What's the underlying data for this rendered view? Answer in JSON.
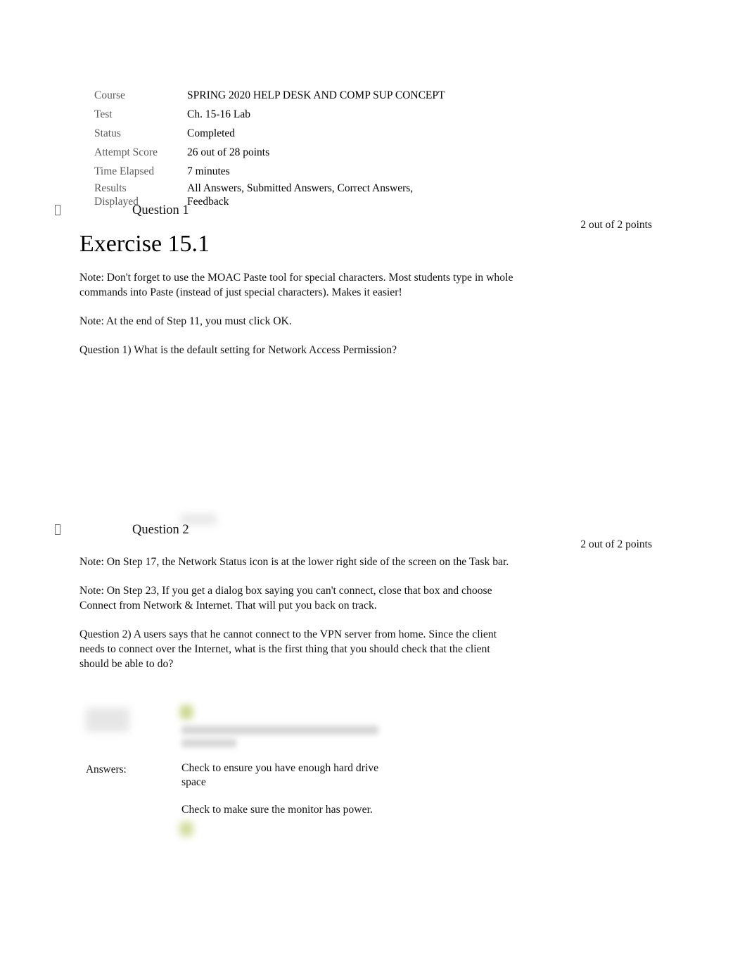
{
  "document": {
    "type": "test-review",
    "colors": {
      "label_gray": "#5a5a5a",
      "body_black": "#111111",
      "highlight_marker": "#c3d07a",
      "redaction_gray": "#d7d7d7",
      "page_background": "#ffffff"
    }
  },
  "meta": {
    "rows": [
      {
        "label": "Course",
        "value": "SPRING 2020 HELP DESK AND COMP SUP CONCEPT"
      },
      {
        "label": "Test",
        "value": "Ch. 15-16 Lab"
      },
      {
        "label": "Status",
        "value": "Completed"
      },
      {
        "label": "Attempt Score",
        "value": "26 out of 28 points"
      },
      {
        "label": "Time Elapsed",
        "value": "7 minutes"
      },
      {
        "label": "Results Displayed",
        "value": "All Answers, Submitted Answers, Correct Answers, Feedback"
      }
    ],
    "results_label_line1": "Results",
    "results_label_line2": "Displayed",
    "results_value_line1": "All Answers, Submitted Answers, Correct Answers,",
    "results_value_line2": "Feedback"
  },
  "questions": [
    {
      "id": "question-1",
      "marker_icon": "missing-glyph-box-icon",
      "title": "Question 1",
      "points": "2 out of 2 points",
      "heading": "Exercise 15.1",
      "paragraphs": [
        "Note: Don't forget to use the MOAC Paste tool for special characters. Most students type in whole commands into Paste (instead of just special characters). Makes it easier!",
        "Note: At the end of Step 11, you must click OK.",
        "Question 1) What is the default setting for Network Access Permission?"
      ],
      "answers": null
    },
    {
      "id": "question-2",
      "marker_icon": "missing-glyph-box-icon",
      "title": "Question 2",
      "points": "2 out of 2 points",
      "heading": null,
      "paragraphs": [
        "Note: On Step 17, the Network Status icon is at the lower right side of the screen on the Task bar.",
        "Note: On Step 23, If you get a dialog box saying you can't connect, close that box and choose Connect from Network & Internet. That will put you back on track.",
        "Question 2) A users says that he cannot connect to the VPN server from home. Since the client needs to connect over the Internet, what is the first thing that you should check that the client should be able to do?"
      ],
      "answers": {
        "label": "Answers:",
        "options": [
          "Check to ensure you have enough hard drive space",
          "Check to make sure the monitor has power."
        ]
      }
    }
  ]
}
